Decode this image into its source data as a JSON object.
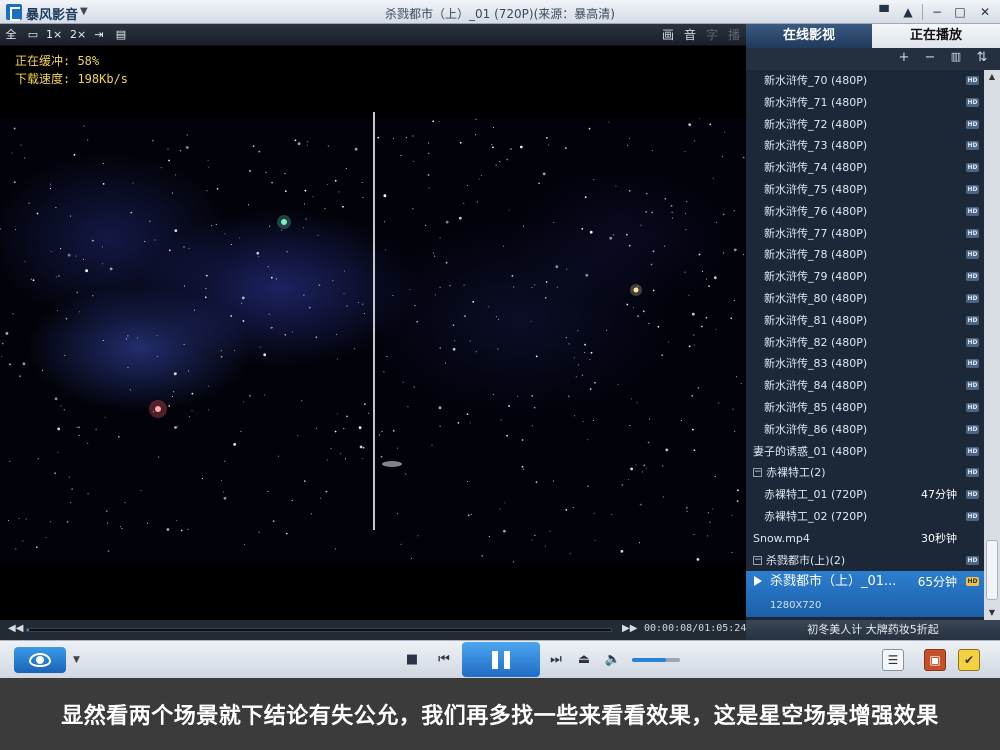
{
  "app": {
    "name": "暴风影音",
    "window_title": "杀戮都市（上）_01 (720P)(来源：暴高清)"
  },
  "video_toolbar": {
    "buttons": [
      "全",
      "1×",
      "2×"
    ],
    "right": [
      "画",
      "音",
      "字",
      "播"
    ]
  },
  "buffer": {
    "status": "正在缓冲: 58%",
    "speed": "下载速度: 198Kb/s"
  },
  "panel": {
    "tabs": [
      "在线影视",
      "正在播放"
    ],
    "toolbar": [
      "+",
      "−",
      "🗑",
      "⇅"
    ],
    "hd_badge": "HD",
    "items": [
      {
        "label": "新水浒传_70 (480P)",
        "dur": ""
      },
      {
        "label": "新水浒传_71 (480P)",
        "dur": ""
      },
      {
        "label": "新水浒传_72 (480P)",
        "dur": ""
      },
      {
        "label": "新水浒传_73 (480P)",
        "dur": ""
      },
      {
        "label": "新水浒传_74 (480P)",
        "dur": ""
      },
      {
        "label": "新水浒传_75 (480P)",
        "dur": ""
      },
      {
        "label": "新水浒传_76 (480P)",
        "dur": ""
      },
      {
        "label": "新水浒传_77 (480P)",
        "dur": ""
      },
      {
        "label": "新水浒传_78 (480P)",
        "dur": ""
      },
      {
        "label": "新水浒传_79 (480P)",
        "dur": ""
      },
      {
        "label": "新水浒传_80 (480P)",
        "dur": ""
      },
      {
        "label": "新水浒传_81 (480P)",
        "dur": ""
      },
      {
        "label": "新水浒传_82 (480P)",
        "dur": ""
      },
      {
        "label": "新水浒传_83 (480P)",
        "dur": ""
      },
      {
        "label": "新水浒传_84 (480P)",
        "dur": ""
      },
      {
        "label": "新水浒传_85 (480P)",
        "dur": ""
      },
      {
        "label": "新水浒传_86 (480P)",
        "dur": ""
      },
      {
        "label": "妻子的诱惑_01 (480P)",
        "dur": ""
      },
      {
        "label": "赤裸特工(2)",
        "dur": ""
      },
      {
        "label": "赤裸特工_01 (720P)",
        "dur": "47分钟"
      },
      {
        "label": "赤裸特工_02 (720P)",
        "dur": ""
      },
      {
        "label": "Snow.mp4",
        "dur": "30秒钟"
      },
      {
        "label": "杀戮都市(上)(2)",
        "dur": ""
      }
    ],
    "active_item": {
      "label": "杀戮都市（上）_01...",
      "dur": "65分钟",
      "resolution": "1280X720"
    },
    "ad_text": "初冬美人计 大牌药妆5折起"
  },
  "seek": {
    "progress": 0.002,
    "time": "00:00:08/01:05:24"
  },
  "volume": {
    "level": 0.7
  },
  "caption": "显然看两个场景就下结论有失公允，我们再多找一些来看看效果，这是星空场景增强效果"
}
